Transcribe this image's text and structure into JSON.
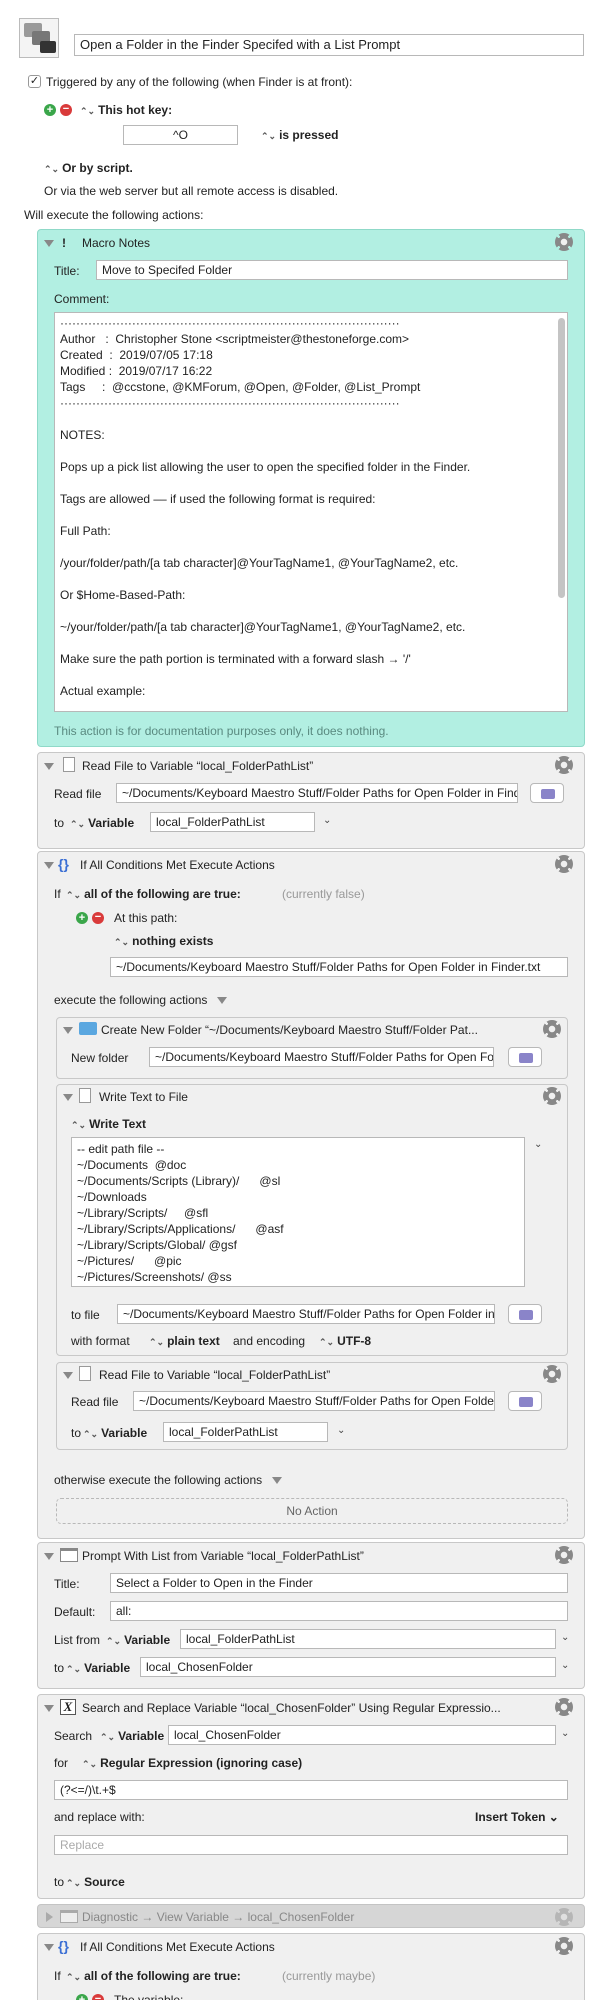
{
  "header": {
    "title": "Open a Folder in the Finder Specifed with a List Prompt"
  },
  "trigger": {
    "checkbox_label": "Triggered by any of the following (when Finder is at front):",
    "hotkey_label": "This hot key:",
    "hotkey_value": "^O",
    "is_pressed": "is pressed",
    "by_script": "Or by script.",
    "web_server": "Or via the web server but all remote access is disabled.",
    "will_execute": "Will execute the following actions:"
  },
  "notes": {
    "title": "Macro Notes",
    "title_label": "Title:",
    "title_value": "Move to Specifed Folder",
    "comment_label": "Comment:",
    "lines": [
      "·····················································································",
      "Author   :  Christopher Stone <scriptmeister@thestoneforge.com>",
      "Created  :  2019/07/05 17:18",
      "Modified :  2019/07/17 16:22",
      "Tags     :  @ccstone, @KMForum, @Open, @Folder, @List_Prompt",
      "·····················································································",
      "",
      "NOTES:",
      "",
      "Pops up a pick list allowing the user to open the specified folder in the Finder.",
      "",
      "Tags are allowed –– if used the following format is required:",
      "",
      "Full Path:",
      "",
      "/your/folder/path/[a tab character]@YourTagName1, @YourTagName2, etc.",
      "",
      "Or $Home-Based-Path:",
      "",
      "~/your/folder/path/[a tab character]@YourTagName1, @YourTagName2, etc.",
      "",
      "Make sure the path portion is terminated with a forward slash → '/'",
      "",
      "Actual example:",
      "",
      "~/Pictures/Screenshots/      @ssh"
    ],
    "footer": "This action is for documentation purposes only, it does nothing."
  },
  "read1": {
    "title": "Read File to Variable “local_FolderPathList”",
    "read_file_label": "Read file",
    "path": "~/Documents/Keyboard Maestro Stuff/Folder Paths for Open Folder in Finder.txt",
    "to_label": "to",
    "variable_label": "Variable",
    "variable_value": "local_FolderPathList"
  },
  "if1": {
    "title": "If All Conditions Met Execute Actions",
    "if_label": "If",
    "condition": "all of the following are true:",
    "status": "(currently false)",
    "at_path": "At this path:",
    "nothing_exists": "nothing exists",
    "path": "~/Documents/Keyboard Maestro Stuff/Folder Paths for Open Folder in Finder.txt",
    "execute_label": "execute the following actions",
    "otherwise_label": "otherwise execute the following actions",
    "no_action": "No Action"
  },
  "newfolder": {
    "title": "Create New Folder “~/Documents/Keyboard Maestro Stuff/Folder Pat...",
    "label": "New folder",
    "path": "~/Documents/Keyboard Maestro Stuff/Folder Paths for Open Folder"
  },
  "write": {
    "title": "Write Text to File",
    "write_label": "Write Text",
    "lines": [
      "-- edit path file --",
      "~/Documents  @doc",
      "~/Documents/Scripts (Library)/      @sl",
      "~/Downloads",
      "~/Library/Scripts/     @sfl",
      "~/Library/Scripts/Applications/      @asf",
      "~/Library/Scripts/Global/ @gsf",
      "~/Pictures/      @pic",
      "~/Pictures/Screenshots/ @ss"
    ],
    "to_file_label": "to file",
    "path": "~/Documents/Keyboard Maestro Stuff/Folder Paths for Open Folder in Finder.txt",
    "with_format": "with format",
    "format": "plain text",
    "and_encoding": "and encoding",
    "encoding": "UTF-8"
  },
  "read2": {
    "title": "Read File to Variable “local_FolderPathList”",
    "read_file_label": "Read file",
    "path": "~/Documents/Keyboard Maestro Stuff/Folder Paths for Open Folder in Finder.txt",
    "to_label": "to",
    "variable_label": "Variable",
    "variable_value": "local_FolderPathList"
  },
  "prompt": {
    "title": "Prompt With List from Variable “local_FolderPathList”",
    "title_label": "Title:",
    "title_value": "Select a Folder to Open in the Finder",
    "default_label": "Default:",
    "default_value": "all:",
    "list_from_label": "List from",
    "variable_label": "Variable",
    "list_value": "local_FolderPathList",
    "to_label": "to",
    "to_value": "local_ChosenFolder"
  },
  "search": {
    "title": "Search and Replace Variable “local_ChosenFolder” Using Regular Expressio...",
    "search_label": "Search",
    "variable_label": "Variable",
    "variable_value": "local_ChosenFolder",
    "for_label": "for",
    "regex_label": "Regular Expression (ignoring case)",
    "pattern": "(?<=/)\\t.+$",
    "replace_with": "and replace with:",
    "insert_token": "Insert Token",
    "replace_placeholder": "Replace",
    "to_label": "to",
    "source_label": "Source"
  },
  "diag": {
    "title": "Diagnostic → View Variable → local_ChosenFolder"
  },
  "if2": {
    "title": "If All Conditions Met Execute Actions",
    "if_label": "If",
    "condition": "all of the following are true:",
    "status": "(currently maybe)",
    "the_variable": "The variable:"
  }
}
